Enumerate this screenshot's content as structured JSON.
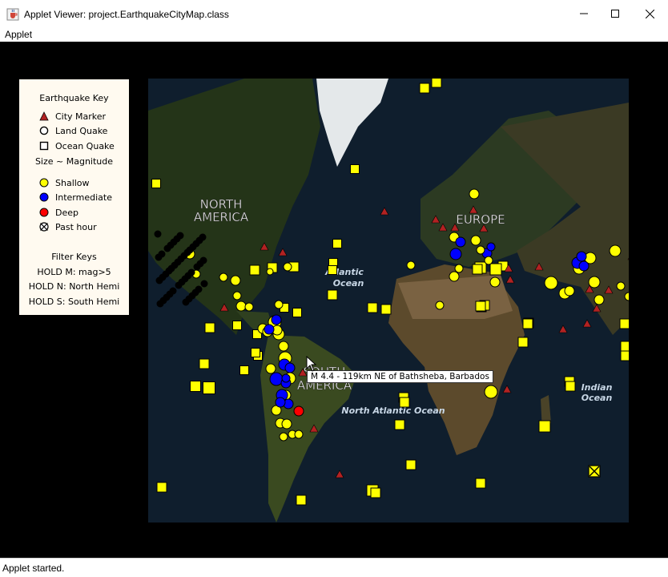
{
  "window": {
    "title": "Applet Viewer: project.EarthquakeCityMap.class",
    "menu": [
      "Applet"
    ],
    "status": "Applet started."
  },
  "key": {
    "title": "Earthquake Key",
    "city_marker": "City Marker",
    "land_quake": "Land Quake",
    "ocean_quake": "Ocean Quake",
    "size_note": "Size ~ Magnitude",
    "shallow": "Shallow",
    "intermediate": "Intermediate",
    "deep": "Deep",
    "past_hour": "Past hour",
    "filter_title": "Filter Keys",
    "filter_m": "HOLD M: mag>5",
    "filter_n": "HOLD N: North Hemi",
    "filter_s": "HOLD S: South Hemi"
  },
  "map_labels": {
    "north_america": [
      "NORTH",
      "AMERICA"
    ],
    "south_america": [
      "SOUTH",
      "AMERICA"
    ],
    "europe": "EUROPE",
    "atlantic": [
      "Atlantic",
      "Ocean"
    ],
    "north_atlantic": "North Atlantic Ocean",
    "indian": [
      "Indian",
      "Ocean"
    ]
  },
  "tooltip": "M 4.4 - 119km NE of Bathsheba, Barbados",
  "colors": {
    "shallow": "#ffff00",
    "intermediate": "#0000ff",
    "deep": "#ff0000",
    "city": "#b22222",
    "key_bg": "#fffaf0"
  }
}
